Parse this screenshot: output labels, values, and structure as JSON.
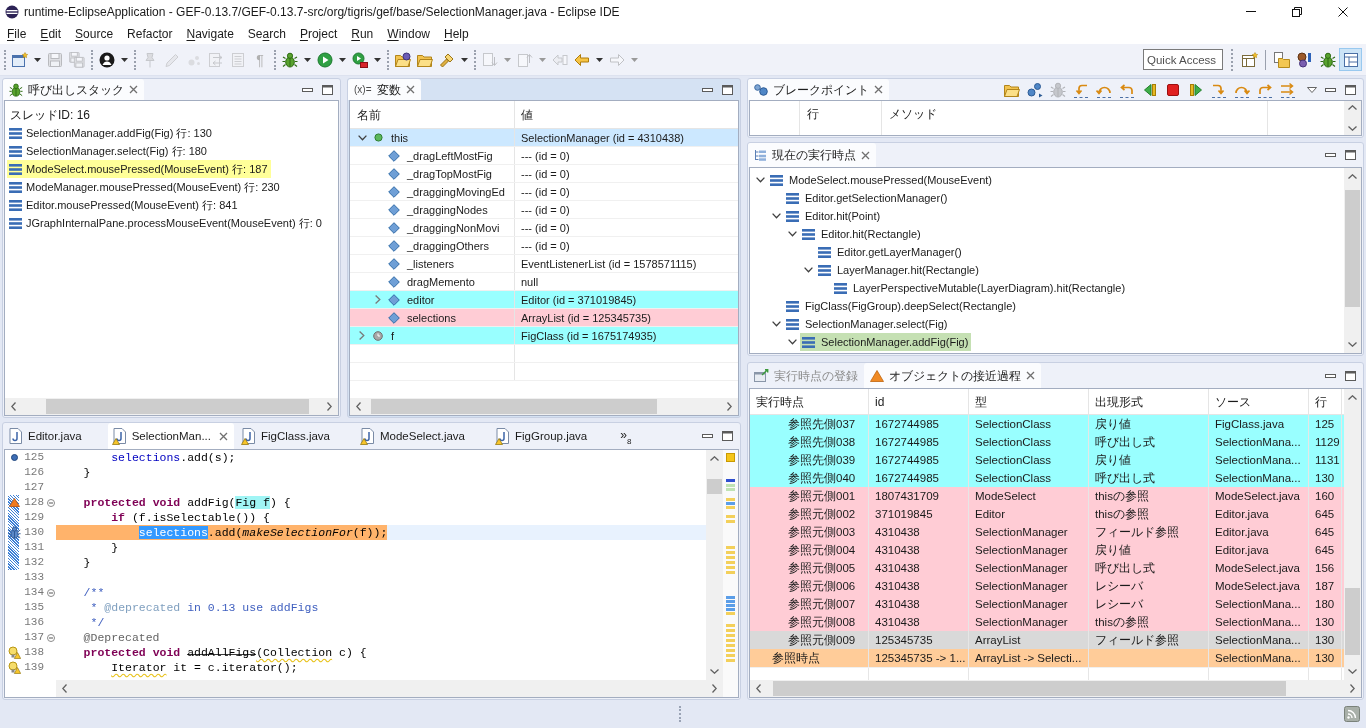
{
  "window": {
    "title": "runtime-EclipseApplication - GEF-0.13.7/GEF-0.13.7-src/org/tigris/gef/base/SelectionManager.java - Eclipse IDE"
  },
  "menu": [
    {
      "key": "F",
      "post": "ile"
    },
    {
      "key": "E",
      "post": "dit"
    },
    {
      "key": "S",
      "post": "ource"
    },
    {
      "pre": "Refac",
      "key": "t",
      "post": "or"
    },
    {
      "key": "N",
      "post": "avigate"
    },
    {
      "pre": "Se",
      "key": "a",
      "post": "rch"
    },
    {
      "key": "P",
      "post": "roject"
    },
    {
      "key": "R",
      "post": "un"
    },
    {
      "key": "W",
      "post": "indow"
    },
    {
      "key": "H",
      "post": "elp"
    }
  ],
  "toolbar": {
    "groups": [
      {
        "items": [
          {
            "kind": "new",
            "disabled": false,
            "dropdown": true
          },
          {
            "kind": "save",
            "disabled": true,
            "dropdown": false
          },
          {
            "kind": "save-all",
            "disabled": true,
            "dropdown": false
          }
        ]
      },
      {
        "items": [
          {
            "kind": "profile",
            "disabled": false,
            "dropdown": true
          }
        ]
      },
      {
        "items": [
          {
            "kind": "pin",
            "disabled": true,
            "dropdown": false
          },
          {
            "kind": "pen",
            "disabled": true,
            "dropdown": false
          },
          {
            "kind": "dots",
            "disabled": true,
            "dropdown": false
          },
          {
            "kind": "page-arrows",
            "disabled": true,
            "dropdown": false
          },
          {
            "kind": "document",
            "disabled": true,
            "dropdown": false
          },
          {
            "kind": "glyph",
            "glyph": "¶",
            "disabled": true,
            "dropdown": false
          }
        ]
      },
      {
        "items": [
          {
            "kind": "debug",
            "disabled": false,
            "dropdown": true
          },
          {
            "kind": "run",
            "disabled": false,
            "dropdown": true
          },
          {
            "kind": "external",
            "disabled": false,
            "dropdown": true
          }
        ]
      },
      {
        "items": [
          {
            "kind": "open-type",
            "disabled": false,
            "dropdown": false
          },
          {
            "kind": "open-folder",
            "disabled": false,
            "dropdown": false
          },
          {
            "kind": "search",
            "disabled": false,
            "dropdown": true
          }
        ]
      },
      {
        "items": [
          {
            "kind": "next",
            "disabled": true,
            "dropdown": true
          },
          {
            "kind": "prev",
            "disabled": true,
            "dropdown": true
          },
          {
            "kind": "last-edit",
            "disabled": true,
            "dropdown": false
          },
          {
            "kind": "back",
            "disabled": false,
            "dropdown": true
          },
          {
            "kind": "forward",
            "disabled": true,
            "dropdown": true
          }
        ]
      }
    ],
    "quick_access": {
      "placeholder": "Quick Access"
    },
    "perspectives": [
      {
        "kind": "resource",
        "selected": false
      },
      {
        "kind": "plugin",
        "selected": false
      },
      {
        "kind": "debug",
        "selected": false
      },
      {
        "kind": "layout",
        "selected": true
      }
    ]
  },
  "call_stack": {
    "active": false,
    "tab": {
      "label": "呼び出しスタック",
      "selected": true
    },
    "thread": "スレッドID: 16",
    "frames": [
      {
        "label": "SelectionManager.addFig(Fig) 行: 130",
        "selected": false
      },
      {
        "label": "SelectionManager.select(Fig) 行: 180",
        "selected": false
      },
      {
        "label": "ModeSelect.mousePressed(MouseEvent) 行: 187",
        "selected": true
      },
      {
        "label": "ModeManager.mousePressed(MouseEvent) 行: 230",
        "selected": false
      },
      {
        "label": "Editor.mousePressed(MouseEvent) 行: 841",
        "selected": false
      },
      {
        "label": "JGraphInternalPane.processMouseEvent(MouseEvent) 行: 0",
        "selected": false
      }
    ]
  },
  "variables": {
    "active": true,
    "tab": {
      "icon_text": "(x)=",
      "label": "変数",
      "selected": true
    },
    "columns": [
      "名前",
      "値"
    ],
    "rows": [
      {
        "kind": "object",
        "name": "this",
        "value": "SelectionManager (id = 4310438)",
        "expanded": true,
        "selected": true,
        "children": [
          {
            "kind": "field",
            "name": "_dragLeftMostFig",
            "value": "--- (id = 0)",
            "selected": false
          },
          {
            "kind": "field",
            "name": "_dragTopMostFig",
            "value": "--- (id = 0)",
            "selected": false
          },
          {
            "kind": "field",
            "name": "_draggingMovingEd",
            "value": "--- (id = 0)",
            "selected": false
          },
          {
            "kind": "field",
            "name": "_draggingNodes",
            "value": "--- (id = 0)",
            "selected": false
          },
          {
            "kind": "field",
            "name": "_draggingNonMovi",
            "value": "--- (id = 0)",
            "selected": false
          },
          {
            "kind": "field",
            "name": "_draggingOthers",
            "value": "--- (id = 0)",
            "selected": false
          },
          {
            "kind": "field",
            "name": "_listeners",
            "value": "EventListenerList (id = 1578571115)",
            "selected": false
          },
          {
            "kind": "field",
            "name": "dragMemento",
            "value": "null",
            "selected": false
          },
          {
            "kind": "field",
            "name": "editor",
            "value": "Editor (id = 371019845)",
            "expanded": false,
            "selected": false,
            "color": "#99ffff"
          },
          {
            "kind": "field",
            "name": "selections",
            "value": "ArrayList (id = 125345735)",
            "selected": false,
            "color": "#ffccd5"
          }
        ]
      },
      {
        "kind": "local",
        "name": "f",
        "value": "FigClass (id = 1675174935)",
        "expanded": false,
        "selected": false,
        "color": "#99ffff"
      }
    ]
  },
  "breakpoints": {
    "active": false,
    "tab": {
      "label": "ブレークポイント",
      "selected": true
    },
    "toolbar": [
      {
        "kind": "folder",
        "disabled": false
      },
      {
        "kind": "nodes",
        "disabled": false
      },
      {
        "kind": "bug",
        "disabled": true
      },
      {
        "kind": "step-back-into",
        "disabled": false
      },
      {
        "kind": "step-back-over",
        "disabled": false
      },
      {
        "kind": "step-back-return",
        "disabled": false
      },
      {
        "kind": "play-back",
        "disabled": false
      },
      {
        "kind": "stop",
        "disabled": false
      },
      {
        "kind": "play",
        "disabled": false
      },
      {
        "kind": "step-into",
        "disabled": false
      },
      {
        "kind": "step-over",
        "disabled": false
      },
      {
        "kind": "step-return",
        "disabled": false
      },
      {
        "kind": "step-forward",
        "disabled": false
      }
    ],
    "columns": [
      "行",
      "メソッド"
    ]
  },
  "execution_point": {
    "active": false,
    "tab": {
      "label": "現在の実行時点",
      "selected": true
    },
    "tree": [
      {
        "label": "ModeSelect.mousePressed(MouseEvent)",
        "expanded": true,
        "selected": false,
        "children": [
          {
            "label": "Editor.getSelectionManager()",
            "selected": false
          },
          {
            "label": "Editor.hit(Point)",
            "expanded": true,
            "selected": false,
            "children": [
              {
                "label": "Editor.hit(Rectangle)",
                "expanded": true,
                "selected": false,
                "children": [
                  {
                    "label": "Editor.getLayerManager()",
                    "selected": false
                  },
                  {
                    "label": "LayerManager.hit(Rectangle)",
                    "expanded": true,
                    "selected": false,
                    "children": [
                      {
                        "label": "LayerPerspectiveMutable(LayerDiagram).hit(Rectangle)",
                        "selected": false
                      }
                    ]
                  }
                ]
              }
            ]
          },
          {
            "label": "FigClass(FigGroup).deepSelect(Rectangle)",
            "selected": false
          },
          {
            "label": "SelectionManager.select(Fig)",
            "expanded": true,
            "selected": false,
            "children": [
              {
                "label": "SelectionManager.addFig(Fig)",
                "expanded": true,
                "selected": true
              }
            ]
          }
        ]
      }
    ]
  },
  "object_trace": {
    "active": false,
    "tabs": [
      {
        "kind": "register",
        "label": "実行時点の登録",
        "selected": false
      },
      {
        "kind": "trace",
        "label": "オブジェクトの接近過程",
        "selected": true
      }
    ],
    "columns": [
      "実行時点",
      "id",
      "型",
      "出現形式",
      "ソース",
      "行"
    ],
    "rows": [
      {
        "kind": "ref",
        "color": "#99ffff",
        "point": "参照先側037",
        "id": "1672744985",
        "type": "SelectionClass",
        "occurrence": "戻り値",
        "source": "FigClass.java",
        "line": "125"
      },
      {
        "kind": "ref",
        "color": "#99ffff",
        "point": "参照先側038",
        "id": "1672744985",
        "type": "SelectionClass",
        "occurrence": "呼び出し式",
        "source": "SelectionMana...",
        "line": "1129"
      },
      {
        "kind": "ref",
        "color": "#99ffff",
        "point": "参照先側039",
        "id": "1672744985",
        "type": "SelectionClass",
        "occurrence": "戻り値",
        "source": "SelectionMana...",
        "line": "1131"
      },
      {
        "kind": "ref",
        "color": "#99ffff",
        "point": "参照先側040",
        "id": "1672744985",
        "type": "SelectionClass",
        "occurrence": "呼び出し式",
        "source": "SelectionMana...",
        "line": "130"
      },
      {
        "kind": "ref",
        "color": "#ffccd5",
        "point": "参照元側001",
        "id": "1807431709",
        "type": "ModeSelect",
        "occurrence": "thisの参照",
        "source": "ModeSelect.java",
        "line": "160"
      },
      {
        "kind": "ref",
        "color": "#ffccd5",
        "point": "参照元側002",
        "id": "371019845",
        "type": "Editor",
        "occurrence": "thisの参照",
        "source": "Editor.java",
        "line": "645"
      },
      {
        "kind": "ref",
        "color": "#ffccd5",
        "point": "参照元側003",
        "id": "4310438",
        "type": "SelectionManager",
        "occurrence": "フィールド参照",
        "source": "Editor.java",
        "line": "645"
      },
      {
        "kind": "ref",
        "color": "#ffccd5",
        "point": "参照元側004",
        "id": "4310438",
        "type": "SelectionManager",
        "occurrence": "戻り値",
        "source": "Editor.java",
        "line": "645"
      },
      {
        "kind": "ref",
        "color": "#ffccd5",
        "point": "参照元側005",
        "id": "4310438",
        "type": "SelectionManager",
        "occurrence": "呼び出し式",
        "source": "ModeSelect.java",
        "line": "156"
      },
      {
        "kind": "ref",
        "color": "#ffccd5",
        "point": "参照元側006",
        "id": "4310438",
        "type": "SelectionManager",
        "occurrence": "レシーバ",
        "source": "ModeSelect.java",
        "line": "187"
      },
      {
        "kind": "ref",
        "color": "#ffccd5",
        "point": "参照元側007",
        "id": "4310438",
        "type": "SelectionManager",
        "occurrence": "レシーバ",
        "source": "SelectionMana...",
        "line": "180"
      },
      {
        "kind": "ref",
        "color": "#ffccd5",
        "point": "参照元側008",
        "id": "4310438",
        "type": "SelectionManager",
        "occurrence": "thisの参照",
        "source": "SelectionMana...",
        "line": "130"
      },
      {
        "kind": "ref",
        "color": "#d9d9d9",
        "point": "参照元側009",
        "id": "125345735",
        "type": "ArrayList",
        "occurrence": "フィールド参照",
        "source": "SelectionMana...",
        "line": "130"
      },
      {
        "kind": "point",
        "color": "#ffcc99",
        "point": "参照時点",
        "id": "125345735 -> 1...",
        "type": "ArrayList -> Selecti...",
        "source": "SelectionMana...",
        "line": "130"
      }
    ]
  },
  "editor": {
    "active": false,
    "tabs": [
      {
        "label": "Editor.java",
        "selected": false,
        "warning": false
      },
      {
        "label": "SelectionMan...",
        "selected": true,
        "warning": true
      },
      {
        "label": "FigClass.java",
        "selected": false,
        "warning": true
      },
      {
        "label": "ModeSelect.java",
        "selected": false,
        "warning": true
      },
      {
        "label": "FigGroup.java",
        "selected": false,
        "warning": true
      }
    ],
    "overflow": {
      "chevron": "»",
      "count": "8"
    },
    "lines": [
      {
        "number": "125",
        "marker": {
          "kind": "breakpoint"
        },
        "fold": false,
        "in_range": false,
        "current": false,
        "tokens": [
          {
            "text": "        selections",
            "kind": "field"
          },
          {
            "text": ".add(s);"
          }
        ]
      },
      {
        "number": "126",
        "fold": false,
        "in_range": false,
        "current": false,
        "tokens": [
          {
            "text": "    }"
          }
        ]
      },
      {
        "number": "127",
        "fold": false,
        "in_range": false,
        "current": false
      },
      {
        "number": "128",
        "marker": {
          "kind": "frame"
        },
        "fold": true,
        "in_range": true,
        "current": false,
        "tokens": [
          {
            "text": "    protected",
            "kind": "keyword"
          },
          {
            "text": " void",
            "kind": "keyword"
          },
          {
            "text": " addFig("
          },
          {
            "text": "Fig f",
            "kind": "occurrence"
          },
          {
            "text": ") {"
          }
        ]
      },
      {
        "number": "129",
        "fold": false,
        "in_range": true,
        "current": false,
        "tokens": [
          {
            "text": "        if",
            "kind": "keyword"
          },
          {
            "text": " (f.isSelectable()) {"
          }
        ]
      },
      {
        "number": "130",
        "marker": {
          "kind": "instruction"
        },
        "fold": false,
        "in_range": true,
        "current": true,
        "tokens": [
          {
            "text": "            selections",
            "kind": "selection"
          },
          {
            "text": ".add("
          },
          {
            "text": "makeSelectionFor",
            "kind": "static"
          },
          {
            "text": "(f));"
          }
        ]
      },
      {
        "number": "131",
        "fold": false,
        "in_range": true,
        "current": false,
        "tokens": [
          {
            "text": "        }"
          }
        ]
      },
      {
        "number": "132",
        "fold": false,
        "in_range": true,
        "current": false,
        "tokens": [
          {
            "text": "    }"
          }
        ]
      },
      {
        "number": "133",
        "fold": false,
        "in_range": false,
        "current": false
      },
      {
        "number": "134",
        "fold": true,
        "in_range": false,
        "current": false,
        "tokens": [
          {
            "text": "    /**",
            "kind": "javadoc"
          }
        ]
      },
      {
        "number": "135",
        "fold": false,
        "in_range": false,
        "current": false,
        "tokens": [
          {
            "text": "     * ",
            "kind": "javadoc"
          },
          {
            "text": "@deprecated",
            "kind": "javadoc-tag"
          },
          {
            "text": " in 0.13 use addFigs",
            "kind": "javadoc"
          }
        ]
      },
      {
        "number": "136",
        "fold": false,
        "in_range": false,
        "current": false,
        "tokens": [
          {
            "text": "     */",
            "kind": "javadoc"
          }
        ]
      },
      {
        "number": "137",
        "fold": true,
        "in_range": false,
        "current": false,
        "tokens": [
          {
            "text": "    @Deprecated",
            "kind": "annotation"
          }
        ]
      },
      {
        "number": "138",
        "marker": {
          "kind": "warning"
        },
        "fold": false,
        "in_range": false,
        "current": false,
        "tokens": [
          {
            "text": "    protected",
            "kind": "keyword"
          },
          {
            "text": " void",
            "kind": "keyword"
          },
          {
            "text": " addAllFigs",
            "kind": "deprecated"
          },
          {
            "text": "(Collection",
            "kind": "warning"
          },
          {
            "text": " c) {"
          }
        ]
      },
      {
        "number": "139",
        "marker": {
          "kind": "warning"
        },
        "fold": false,
        "in_range": false,
        "current": false,
        "tokens": [
          {
            "text": "        Iterator",
            "kind": "warning"
          },
          {
            "text": " it = c.iterator();"
          }
        ]
      }
    ]
  }
}
